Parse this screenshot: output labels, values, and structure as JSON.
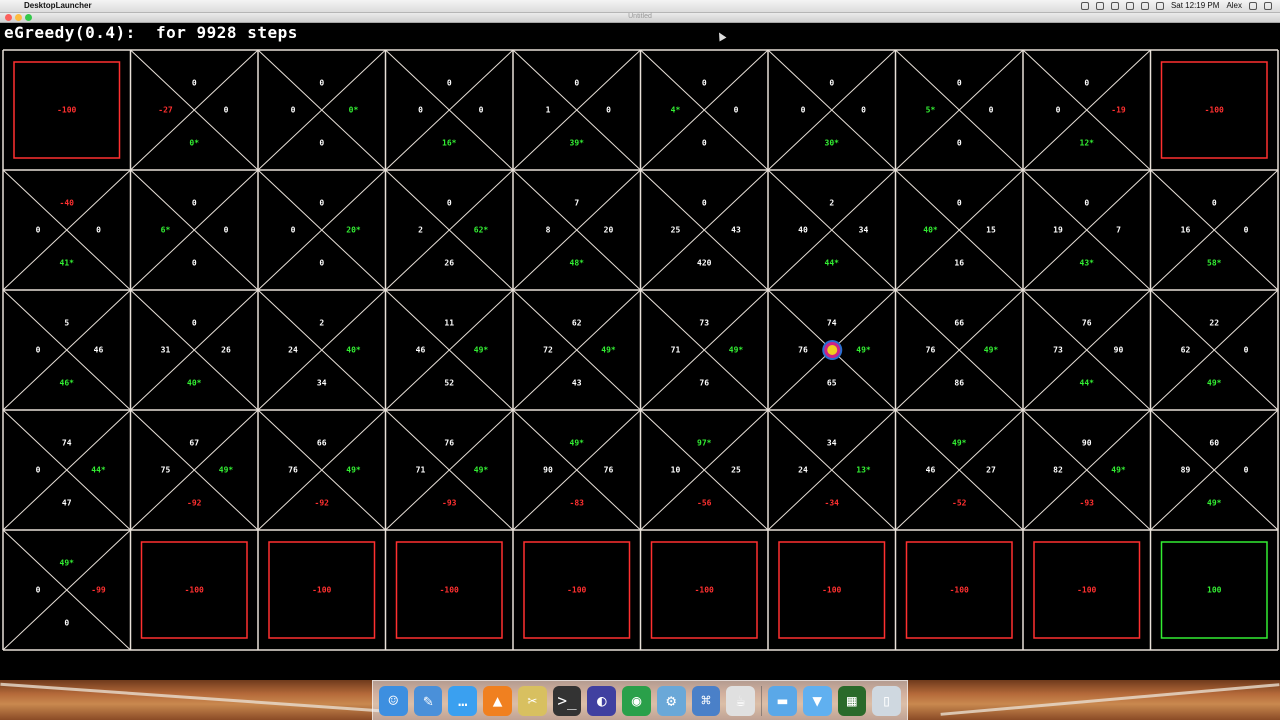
{
  "menubar": {
    "app_name": "DesktopLauncher",
    "clock": "Sat 12:19 PM",
    "user": "Alex"
  },
  "window": {
    "title": "Untitled"
  },
  "status": {
    "text": "eGreedy(0.4):  for 9928 steps"
  },
  "colors": {
    "grid_line": "#e8e0d8",
    "negative": "#ff3030",
    "positive_best": "#33ee33",
    "neutral": "#ffffff",
    "agent": "#cc2288"
  },
  "grid": {
    "rows": 5,
    "cols": 10,
    "agent": {
      "row": 2,
      "col": 6
    },
    "cells": [
      [
        {
          "type": "terminal",
          "value": "-100",
          "color": "red"
        },
        {
          "type": "q",
          "n": "0",
          "w": "-27",
          "e": "0",
          "s": "0*"
        },
        {
          "type": "q",
          "n": "0",
          "w": "0",
          "e": "0*",
          "s": "0"
        },
        {
          "type": "q",
          "n": "0",
          "w": "0",
          "e": "0",
          "s": "16*"
        },
        {
          "type": "q",
          "n": "0",
          "w": "1",
          "e": "0",
          "s": "39*"
        },
        {
          "type": "q",
          "n": "0",
          "w": "4*",
          "e": "0",
          "s": "0"
        },
        {
          "type": "q",
          "n": "0",
          "w": "0",
          "e": "0",
          "s": "30*"
        },
        {
          "type": "q",
          "n": "0",
          "w": "5*",
          "e": "0",
          "s": "0"
        },
        {
          "type": "q",
          "n": "0",
          "w": "0",
          "e": "-19",
          "s": "12*"
        },
        {
          "type": "terminal",
          "value": "-100",
          "color": "red"
        }
      ],
      [
        {
          "type": "q",
          "n": "-40",
          "w": "0",
          "e": "0",
          "s": "41*"
        },
        {
          "type": "q",
          "n": "0",
          "w": "6*",
          "e": "0",
          "s": "0"
        },
        {
          "type": "q",
          "n": "0",
          "w": "0",
          "e": "20*",
          "s": "0"
        },
        {
          "type": "q",
          "n": "0",
          "w": "2",
          "e": "62*",
          "s": "26"
        },
        {
          "type": "q",
          "n": "7",
          "w": "8",
          "e": "20",
          "s": "48*"
        },
        {
          "type": "q",
          "n": "0",
          "w": "25",
          "e": "43",
          "s": "420"
        },
        {
          "type": "q",
          "n": "2",
          "w": "40",
          "e": "34",
          "s": "44*"
        },
        {
          "type": "q",
          "n": "0",
          "w": "40*",
          "e": "15",
          "s": "16"
        },
        {
          "type": "q",
          "n": "0",
          "w": "19",
          "e": "7",
          "s": "43*"
        },
        {
          "type": "q",
          "n": "0",
          "w": "16",
          "e": "0",
          "s": "58*"
        }
      ],
      [
        {
          "type": "q",
          "n": "5",
          "w": "0",
          "e": "46",
          "s": "46*"
        },
        {
          "type": "q",
          "n": "0",
          "w": "31",
          "e": "26",
          "s": "40*"
        },
        {
          "type": "q",
          "n": "2",
          "w": "24",
          "e": "40*",
          "s": "34"
        },
        {
          "type": "q",
          "n": "11",
          "w": "46",
          "e": "49*",
          "s": "52"
        },
        {
          "type": "q",
          "n": "62",
          "w": "72",
          "e": "49*",
          "s": "43"
        },
        {
          "type": "q",
          "n": "73",
          "w": "71",
          "e": "49*",
          "s": "76"
        },
        {
          "type": "q",
          "n": "74",
          "w": "76",
          "e": "49*",
          "s": "65"
        },
        {
          "type": "q",
          "n": "66",
          "w": "76",
          "e": "49*",
          "s": "86"
        },
        {
          "type": "q",
          "n": "76",
          "w": "73",
          "e": "90",
          "s": "44*"
        },
        {
          "type": "q",
          "n": "22",
          "w": "62",
          "e": "0",
          "s": "49*"
        }
      ],
      [
        {
          "type": "q",
          "n": "74",
          "w": "0",
          "e": "44*",
          "s": "47"
        },
        {
          "type": "q",
          "n": "67",
          "w": "75",
          "e": "49*",
          "s": "-92"
        },
        {
          "type": "q",
          "n": "66",
          "w": "76",
          "e": "49*",
          "s": "-92"
        },
        {
          "type": "q",
          "n": "76",
          "w": "71",
          "e": "49*",
          "s": "-93"
        },
        {
          "type": "q",
          "n": "49*",
          "w": "90",
          "e": "76",
          "s": "-83"
        },
        {
          "type": "q",
          "n": "97*",
          "w": "10",
          "e": "25",
          "s": "-56"
        },
        {
          "type": "q",
          "n": "34",
          "w": "24",
          "e": "13*",
          "s": "-34"
        },
        {
          "type": "q",
          "n": "49*",
          "w": "46",
          "e": "27",
          "s": "-52"
        },
        {
          "type": "q",
          "n": "90",
          "w": "82",
          "e": "49*",
          "s": "-93"
        },
        {
          "type": "q",
          "n": "60",
          "w": "89",
          "e": "0",
          "s": "49*"
        }
      ],
      [
        {
          "type": "q",
          "n": "49*",
          "w": "0",
          "e": "-99",
          "s": "0"
        },
        {
          "type": "terminal",
          "value": "-100",
          "color": "red"
        },
        {
          "type": "terminal",
          "value": "-100",
          "color": "red"
        },
        {
          "type": "terminal",
          "value": "-100",
          "color": "red"
        },
        {
          "type": "terminal",
          "value": "-100",
          "color": "red"
        },
        {
          "type": "terminal",
          "value": "-100",
          "color": "red"
        },
        {
          "type": "terminal",
          "value": "-100",
          "color": "red"
        },
        {
          "type": "terminal",
          "value": "-100",
          "color": "red"
        },
        {
          "type": "terminal",
          "value": "-100",
          "color": "red"
        },
        {
          "type": "terminal",
          "value": "100",
          "color": "green"
        }
      ]
    ]
  },
  "dock": {
    "items": [
      {
        "icon": "finder-icon",
        "glyph": "☺",
        "color": "#3d8fe0"
      },
      {
        "icon": "preview-icon",
        "glyph": "✎",
        "color": "#4a90d9"
      },
      {
        "icon": "messages-icon",
        "glyph": "…",
        "color": "#3aa0f0"
      },
      {
        "icon": "vlc-icon",
        "glyph": "▲",
        "color": "#f08020"
      },
      {
        "icon": "scripteditor-icon",
        "glyph": "✂",
        "color": "#d8c060"
      },
      {
        "icon": "terminal-icon",
        "glyph": ">_",
        "color": "#333333"
      },
      {
        "icon": "eclipse-icon",
        "glyph": "◐",
        "color": "#4040a0"
      },
      {
        "icon": "chrome-icon",
        "glyph": "◉",
        "color": "#2aa04a"
      },
      {
        "icon": "network-icon",
        "glyph": "⚙",
        "color": "#6aa8d8"
      },
      {
        "icon": "xcode-icon",
        "glyph": "⌘",
        "color": "#4a80c8"
      },
      {
        "icon": "java-icon",
        "glyph": "☕",
        "color": "#e0e0e0"
      },
      {
        "icon": "folder-icon",
        "glyph": "▬",
        "color": "#5aa8e8"
      },
      {
        "icon": "downloads-icon",
        "glyph": "▼",
        "color": "#60b0f0"
      },
      {
        "icon": "grid-app-icon",
        "glyph": "▦",
        "color": "#2a6a2a"
      },
      {
        "icon": "trash-icon",
        "glyph": "▯",
        "color": "#cfd8e0"
      }
    ]
  }
}
